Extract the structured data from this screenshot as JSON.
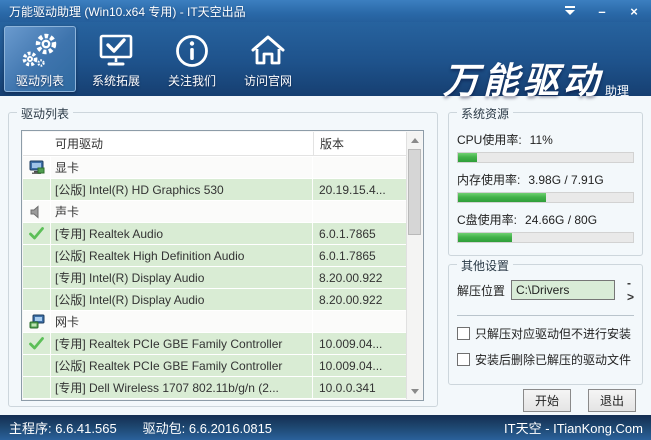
{
  "window": {
    "title": "万能驱动助理 (Win10.x64 专用) - IT天空出品",
    "controls": {
      "menu": "menu-icon",
      "minimize": "–",
      "close": "×"
    }
  },
  "toolbar": {
    "items": [
      {
        "label": "驱动列表",
        "icon": "gears-icon",
        "selected": true
      },
      {
        "label": "系统拓展",
        "icon": "monitor-check-icon",
        "selected": false
      },
      {
        "label": "关注我们",
        "icon": "info-circle-icon",
        "selected": false
      },
      {
        "label": "访问官网",
        "icon": "home-icon",
        "selected": false
      }
    ],
    "logo": {
      "main": "万能驱动",
      "suffix": "助理"
    }
  },
  "driver_panel": {
    "title": "驱动列表",
    "columns": {
      "name": "可用驱动",
      "version": "版本"
    },
    "rows": [
      {
        "type": "category",
        "icon": "display-adapter-icon",
        "checked": false,
        "name": "显卡",
        "version": ""
      },
      {
        "type": "driver",
        "icon": "",
        "checked": false,
        "name": "[公版] Intel(R) HD Graphics 530",
        "version": "20.19.15.4..."
      },
      {
        "type": "category",
        "icon": "speaker-icon",
        "checked": false,
        "name": "声卡",
        "version": ""
      },
      {
        "type": "driver",
        "icon": "",
        "checked": true,
        "name": "[专用] Realtek Audio",
        "version": "6.0.1.7865"
      },
      {
        "type": "driver",
        "icon": "",
        "checked": false,
        "name": "[公版] Realtek High Definition Audio",
        "version": "6.0.1.7865"
      },
      {
        "type": "driver",
        "icon": "",
        "checked": false,
        "name": "[专用] Intel(R) Display Audio",
        "version": "8.20.00.922"
      },
      {
        "type": "driver",
        "icon": "",
        "checked": false,
        "name": "[公版] Intel(R) Display Audio",
        "version": "8.20.00.922"
      },
      {
        "type": "category",
        "icon": "network-icon",
        "checked": false,
        "name": "网卡",
        "version": ""
      },
      {
        "type": "driver",
        "icon": "",
        "checked": true,
        "name": "[专用] Realtek PCIe GBE Family Controller",
        "version": "10.009.04..."
      },
      {
        "type": "driver",
        "icon": "",
        "checked": false,
        "name": "[公版] Realtek PCIe GBE Family Controller",
        "version": "10.009.04..."
      },
      {
        "type": "driver",
        "icon": "",
        "checked": false,
        "name": "[专用] Dell Wireless 1707 802.11b/g/n (2...",
        "version": "10.0.0.341"
      }
    ]
  },
  "system_resources": {
    "title": "系统资源",
    "meters": [
      {
        "label": "CPU使用率:",
        "value": "11%",
        "percent": 11
      },
      {
        "label": "内存使用率:",
        "value": "3.98G / 7.91G",
        "percent": 50
      },
      {
        "label": "C盘使用率:",
        "value": "24.66G / 80G",
        "percent": 31
      }
    ]
  },
  "other_settings": {
    "title": "其他设置",
    "extract_label": "解压位置",
    "extract_path": "C:\\Drivers",
    "browse_label": "->",
    "checkboxes": [
      {
        "label": "只解压对应驱动但不进行安装",
        "checked": false
      },
      {
        "label": "安装后删除已解压的驱动文件",
        "checked": false
      }
    ]
  },
  "actions": {
    "start": "开始",
    "exit": "退出"
  },
  "statusbar": {
    "main_program": "主程序: 6.6.41.565",
    "driver_pack": "驱动包: 6.6.2016.0815",
    "site": "IT天空 - ITianKong.Com"
  },
  "colors": {
    "row_green": "#d9ecd4",
    "meter_green": "#43b24a",
    "titlebar_blue": "#2a69a8",
    "statusbar_navy": "#1d456e"
  }
}
